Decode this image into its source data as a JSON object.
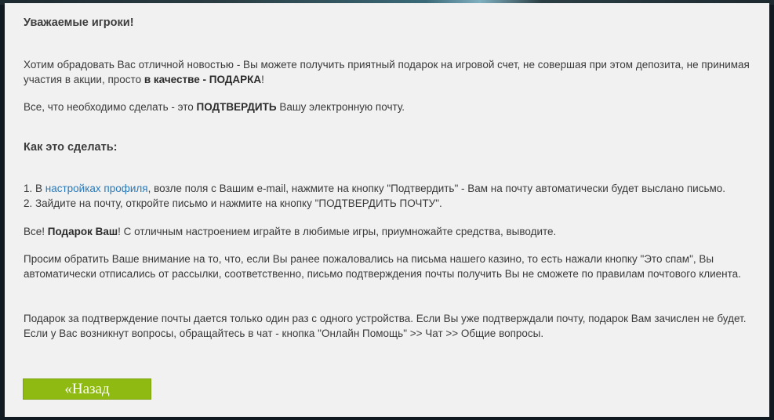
{
  "greeting": "Уважаемые игроки!",
  "intro": {
    "text": "Хотим обрадовать Вас отличной новостью - Вы можете получить приятный подарок на игровой счет, не совершая при этом депозита, не принимая участия в акции, просто ",
    "bold": "в качестве - ПОДАРКА",
    "end": "!"
  },
  "confirm": {
    "text_before": "Все, что необходимо сделать - это ",
    "bold": "ПОДТВЕРДИТЬ",
    "text_after": " Вашу электронную почту."
  },
  "howto_title": "Как это сделать:",
  "steps": {
    "step1_prefix": "1. В ",
    "step1_link": "настройках профиля",
    "step1_suffix": ", возле поля с Вашим e-mail, нажмите на кнопку \"Подтвердить\" - Вам на почту автоматически будет выслано письмо.",
    "step2": "2. Зайдите на почту, откройте письмо и нажмите на кнопку \"ПОДТВЕРДИТЬ ПОЧТУ\"."
  },
  "done": {
    "prefix": "Все! ",
    "bold": "Подарок Ваш",
    "suffix": "! С отличным настроением играйте в любимые игры, приумножайте средства, выводите."
  },
  "spam_note": "Просим обратить Ваше внимание на то, что, если Вы ранее пожаловались на письма нашего казино, то есть нажали кнопку \"Это спам\", Вы автоматически отписались от рассылки, соответственно, письмо подтверждения почты получить Вы не сможете по правилам почтового клиента.",
  "gift_note": "Подарок за подтверждение почты дается только один раз с одного устройства. Если Вы уже подтверждали почту, подарок Вам зачислен не будет.",
  "questions_note": "Если у Вас возникнут вопросы, обращайтесь в чат - кнопка \"Онлайн Помощь\" >> Чат >> Общие вопросы.",
  "back_button": "«Назад",
  "colors": {
    "panel_bg": "#f1f1f1",
    "link": "#2a79b8",
    "button_green": "#8fba12",
    "text": "#3a3a3a"
  }
}
